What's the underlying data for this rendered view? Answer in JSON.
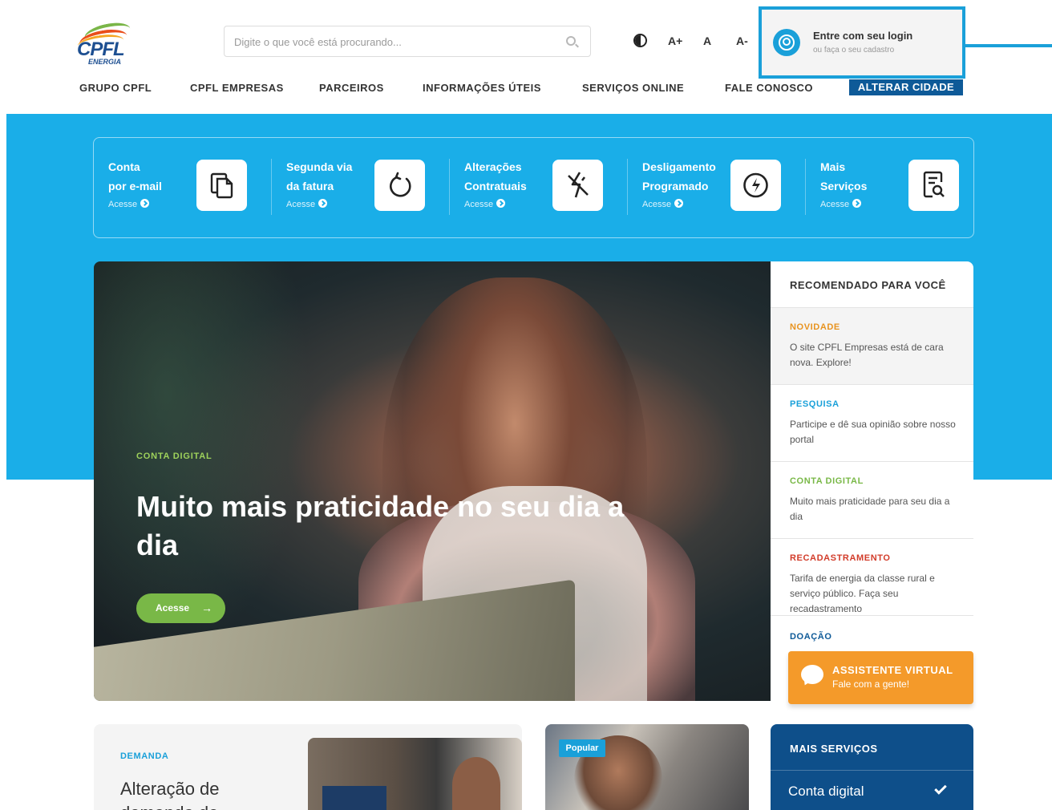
{
  "header": {
    "logo": {
      "brand": "CPFL",
      "sub": "ENERGIA"
    },
    "search": {
      "placeholder": "Digite o que você está procurando..."
    },
    "accessibility": {
      "increase": "A+",
      "normal": "A",
      "decrease": "A-"
    },
    "login": {
      "title": "Entre com seu login",
      "subtitle": "ou faça o seu cadastro"
    },
    "nav": [
      "GRUPO CPFL",
      "CPFL EMPRESAS",
      "PARCEIROS",
      "INFORMAÇÕES ÚTEIS",
      "SERVIÇOS ONLINE",
      "FALE CONOSCO"
    ],
    "alterar_cidade": "ALTERAR CIDADE"
  },
  "quick_links": [
    {
      "line1": "Conta",
      "line2": "por e-mail",
      "cta": "Acesse",
      "icon": "documents-icon"
    },
    {
      "line1": "Segunda via",
      "line2": "da fatura",
      "cta": "Acesse",
      "icon": "refresh-icon"
    },
    {
      "line1": "Alterações",
      "line2": "Contratuais",
      "cta": "Acesse",
      "icon": "no-power-icon"
    },
    {
      "line1": "Desligamento",
      "line2": "Programado",
      "cta": "Acesse",
      "icon": "lightning-icon"
    },
    {
      "line1": "Mais",
      "line2": "Serviços",
      "cta": "Acesse",
      "icon": "document-search-icon"
    }
  ],
  "hero": {
    "tag": "CONTA DIGITAL",
    "headline": "Muito mais praticidade no seu dia a dia",
    "button": "Acesse",
    "button_arrow": "→"
  },
  "recommended": {
    "title": "RECOMENDADO PARA VOCÊ",
    "items": [
      {
        "category": "NOVIDADE",
        "text": "O site CPFL Empresas está de cara nova. Explore!",
        "color": "#e8931e"
      },
      {
        "category": "PESQUISA",
        "text": "Participe e dê sua opinião sobre nosso portal",
        "color": "#1aa0d9"
      },
      {
        "category": "CONTA DIGITAL",
        "text": "Muito mais praticidade para seu dia a dia",
        "color": "#79b847"
      },
      {
        "category": "RECADASTRAMENTO",
        "text": "Tarifa de energia da classe rural e serviço público. Faça seu recadastramento",
        "color": "#d23c2a"
      },
      {
        "category": "DOAÇÃO",
        "text": "",
        "color": "#0e5a98"
      }
    ]
  },
  "assistant": {
    "title": "ASSISTENTE VIRTUAL",
    "subtitle": "Fale com a gente!"
  },
  "cards": {
    "demanda": {
      "category": "DEMANDA",
      "title": "Alteração de demanda de"
    },
    "popular": {
      "badge": "Popular"
    },
    "mais_servicos": {
      "title": "MAIS SERVIÇOS",
      "item": "Conta digital"
    }
  },
  "colors": {
    "primary_blue": "#1aaee8",
    "dark_blue": "#0e5a98",
    "green": "#79b847",
    "orange": "#f49a2a"
  }
}
